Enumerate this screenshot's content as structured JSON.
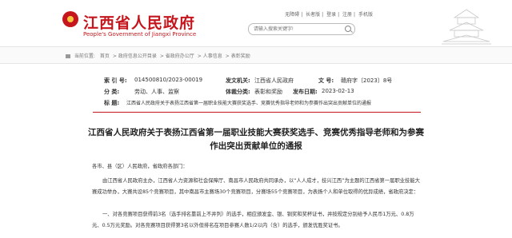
{
  "header": {
    "site_name_cn": "江西省人民政府",
    "site_name_en": "People's Government of Jiangxi Province",
    "top_links": [
      "无障碍",
      "长者版",
      "登录",
      "注册",
      "手机版"
    ],
    "search_placeholder": "请输入搜索关键字!"
  },
  "breadcrumb": {
    "label": "当前位置:",
    "items": [
      "首页",
      "政府信息公开目录",
      "省政府办公厅",
      "人事信息",
      "表彰奖励"
    ]
  },
  "meta": {
    "index_label": "索 引 号:",
    "index_value": "014500810/2023-00019",
    "issuer_label": "发文机关:",
    "issuer_value": "江西省人民政府",
    "docno_label": "文 号:",
    "docno_value": "赣府字〔2023〕8号",
    "category_label": "分 类:",
    "category_value": "劳动、人事、监察",
    "genre_label": "体裁分类:",
    "genre_value": "表彰和奖励",
    "date_label": "发布日期:",
    "date_value": "2023-02-13",
    "title_label": "标 题:",
    "title_value": "江西省人民政府关于表扬江西省第一届职业技能大赛获奖选手、竞赛优秀指导老师和为参赛作出突出贡献单位的通报"
  },
  "article": {
    "title_line1": "江西省人民政府关于表扬江西省第一届职业技能大赛获奖选手、竞赛优秀指导老师和为参赛",
    "title_line2": "作出突出贡献单位的通报",
    "salutation": "各市、县（区）人民政府，省政府各部门：",
    "para1": "由江西省人民政府主办，江西省人力资源和社会保障厅、南昌市人民政府共同承办，以“人人成才，技兴江西”为主题的江西省第一届职业技能大赛成功举办，大赛共设85个竞赛项目，其中南昌市主赛场30个竞赛项目，分赛场55个竞赛项目，为表扬个人和单位取得的优异成绩，省政府决定：",
    "para2": "一、对各竞赛项目获得前3名（选手排名靠前上不并列）的选手，相应颁发金、银、铜奖和奖杯证书，并按规定分别给予人民币1万元、0.8万元、0.5万元奖励。对各竞赛项目获得第3名以外但排名在项目参赛人数1/2以内（含）的选手，颁发优胜奖证书。"
  },
  "colors": {
    "brand_red": "#c4161c"
  }
}
